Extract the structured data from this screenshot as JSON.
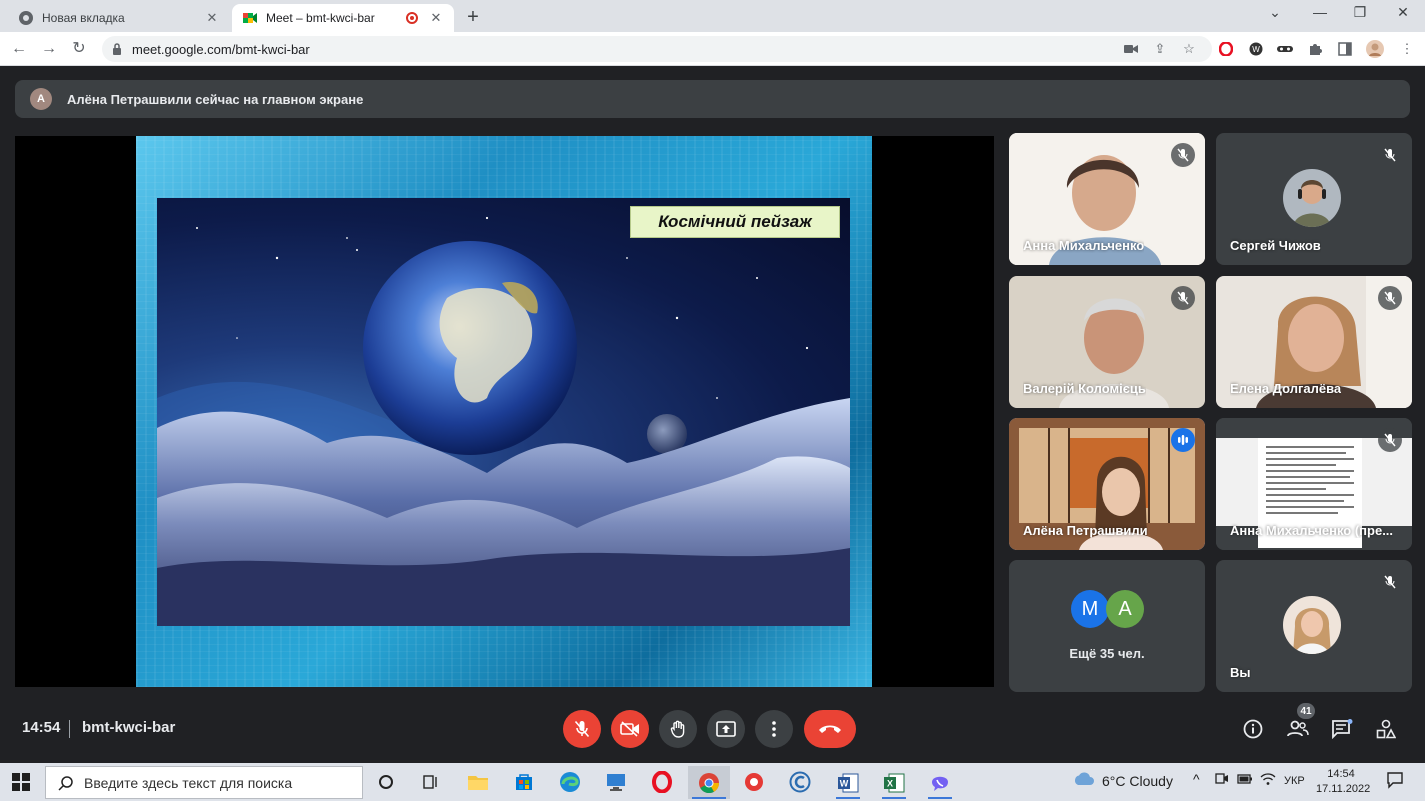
{
  "browser": {
    "tabs": [
      {
        "title": "Новая вкладка",
        "active": false
      },
      {
        "title": "Meet – bmt-kwci-bar",
        "active": true
      }
    ],
    "url": "meet.google.com/bmt-kwci-bar"
  },
  "meet": {
    "banner": {
      "avatar_letter": "А",
      "text": "Алёна Петрашвили сейчас на главном экране"
    },
    "presentation": {
      "slide_title": "Космічний пейзаж"
    },
    "participants": [
      {
        "name": "Анна Михальченко",
        "muted": true
      },
      {
        "name": "Сергей Чижов",
        "muted": true
      },
      {
        "name": "Валерій Коломієць",
        "muted": true
      },
      {
        "name": "Елена Долгалёва",
        "muted": true
      },
      {
        "name": "Алёна Петрашвили",
        "muted": false,
        "speaking": true
      },
      {
        "name": "Анна Михальченко (пре...",
        "muted": true
      },
      {
        "name": "Вы",
        "muted": true
      }
    ],
    "more": {
      "avatars": [
        "M",
        "A"
      ],
      "label": "Ещё 35 чел."
    },
    "bottom": {
      "time": "14:54",
      "meeting_code": "bmt-kwci-bar",
      "people_count": "41"
    }
  },
  "taskbar": {
    "search_placeholder": "Введите здесь текст для поиска",
    "weather": "6°C  Cloudy",
    "language": "УКР",
    "time": "14:54",
    "date": "17.11.2022"
  },
  "colors": {
    "meet_bg": "#202124",
    "tile_bg": "#3c4043",
    "danger": "#ea4335",
    "speaking_outline": "#8ab4f8",
    "accent_blue": "#1a73e8"
  },
  "icons": [
    "chrome-icon",
    "meet-icon",
    "lock-icon",
    "camera-icon",
    "share-icon",
    "star-icon",
    "opera-icon",
    "extension-icon",
    "profile-icon",
    "mic-off-icon",
    "camera-off-icon",
    "raise-hand-icon",
    "present-icon",
    "more-icon",
    "hang-up-icon",
    "info-icon",
    "people-icon",
    "chat-icon",
    "activities-icon",
    "windows-start-icon",
    "search-icon"
  ]
}
